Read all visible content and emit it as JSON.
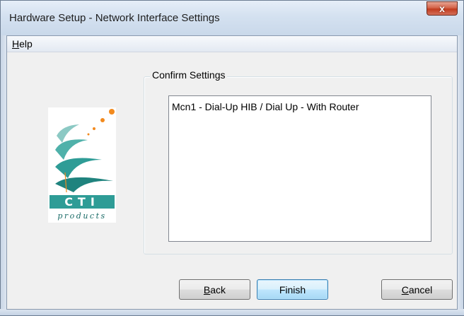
{
  "window": {
    "title": "Hardware Setup - Network Interface Settings",
    "close_label": "x"
  },
  "menu": {
    "help_accel": "H",
    "help_rest": "elp"
  },
  "logo": {
    "brand": "CTI",
    "tagline": "products",
    "colors": {
      "teal": "#2e9c96",
      "orange": "#f28a1e",
      "dark_teal": "#1a6b67"
    }
  },
  "group": {
    "label": "Confirm Settings",
    "items": [
      "Mcn1 - Dial-Up HIB / Dial Up - With Router"
    ]
  },
  "buttons": {
    "back_accel": "B",
    "back_rest": "ack",
    "finish": "Finish",
    "cancel_accel": "C",
    "cancel_rest": "ancel"
  }
}
